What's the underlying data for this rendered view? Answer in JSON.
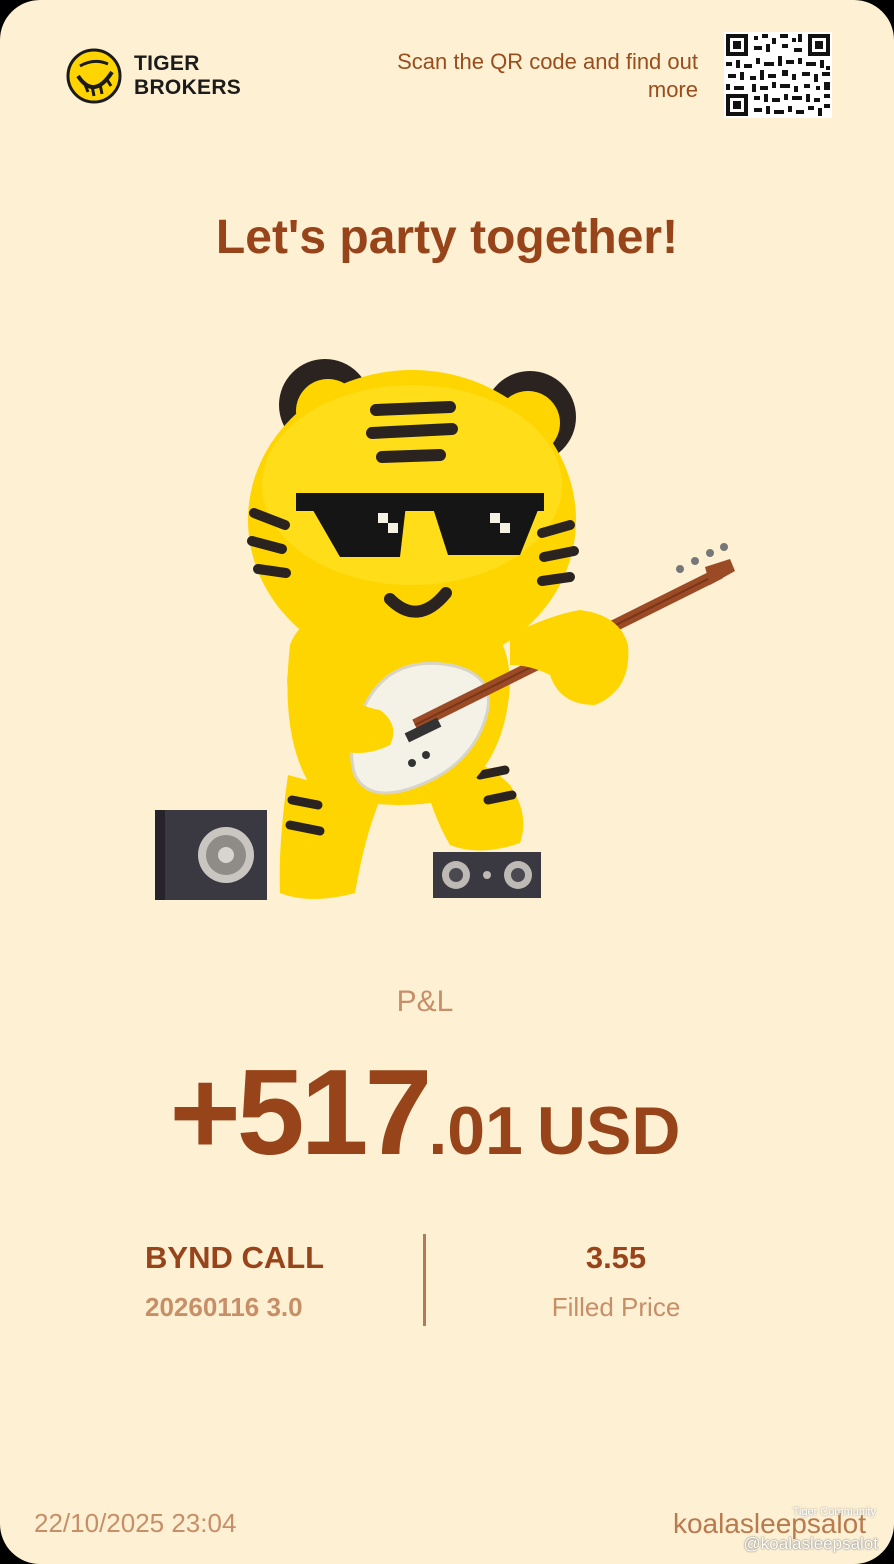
{
  "brand": {
    "line1": "TIGER",
    "line2": "BROKERS"
  },
  "scan_text": "Scan the QR code and find out more",
  "headline": "Let's party together!",
  "pnl": {
    "label": "P&L",
    "main": "+517",
    "decimal": ".01",
    "currency": "USD"
  },
  "contract": {
    "name": "BYND CALL",
    "detail": "20260116 3.0"
  },
  "fill": {
    "value": "3.55",
    "label": "Filled Price"
  },
  "timestamp": "22/10/2025 23:04",
  "username": "koalasleepsalot",
  "watermark": {
    "top": "Tiger Community",
    "handle": "@koalasleepsalot"
  },
  "colors": {
    "background": "#fdf0d3",
    "accent": "#97441a",
    "muted": "#c68f68",
    "mascot": "#ffdd00"
  }
}
